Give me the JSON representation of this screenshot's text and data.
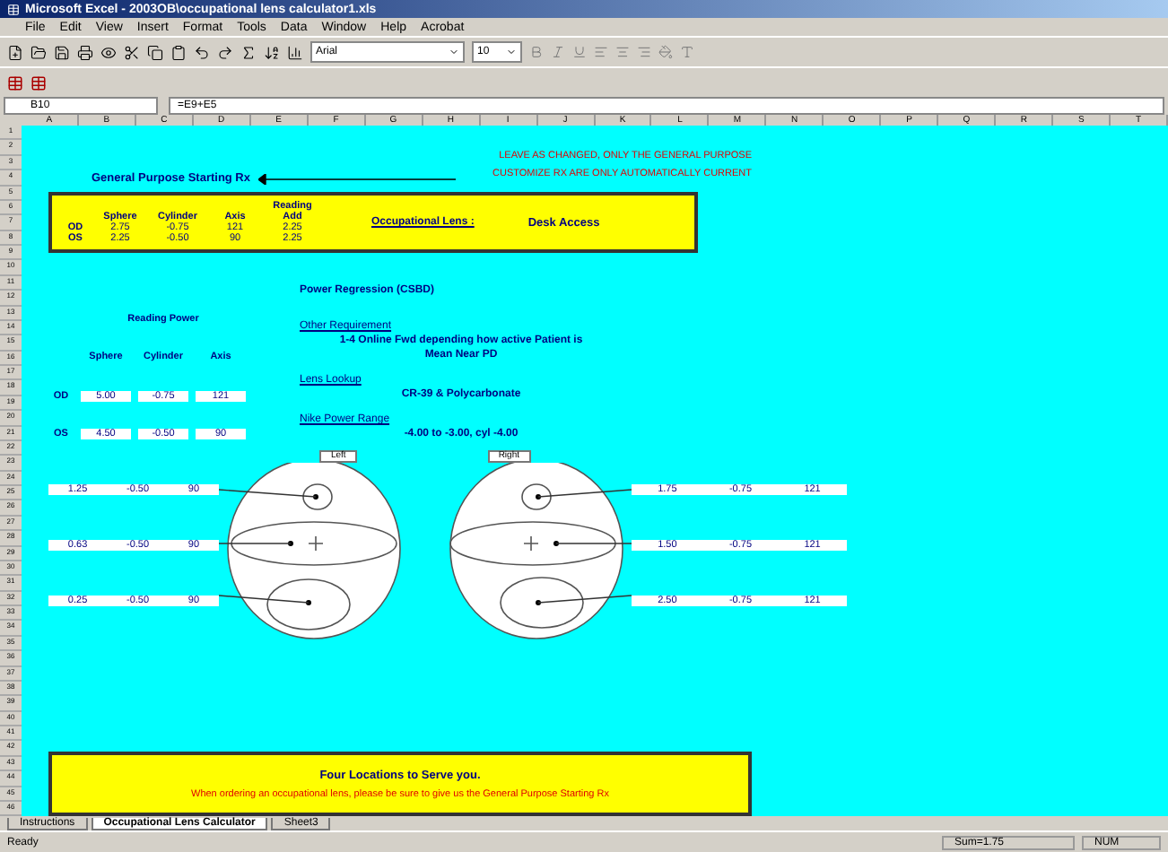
{
  "window": {
    "title": "Microsoft Excel - 2003OB\\occupational lens calculator1.xls"
  },
  "menu": [
    "File",
    "Edit",
    "View",
    "Insert",
    "Format",
    "Tools",
    "Data",
    "Window",
    "Help",
    "Acrobat"
  ],
  "toolbar": {
    "font": "Arial",
    "size": "10"
  },
  "formula_bar": {
    "cell": "B10",
    "formula": "=E9+E5"
  },
  "columns": [
    "A",
    "B",
    "C",
    "D",
    "E",
    "F",
    "G",
    "H",
    "I",
    "J",
    "K",
    "L",
    "M",
    "N",
    "O",
    "P",
    "Q",
    "R",
    "S",
    "T"
  ],
  "rows": [
    "1",
    "2",
    "3",
    "4",
    "5",
    "6",
    "7",
    "8",
    "9",
    "10",
    "11",
    "12",
    "13",
    "14",
    "15",
    "16",
    "17",
    "18",
    "19",
    "20",
    "21",
    "22",
    "23",
    "24",
    "25",
    "26",
    "27",
    "28",
    "29",
    "30",
    "31",
    "32",
    "33",
    "34",
    "35",
    "36",
    "37",
    "38",
    "39",
    "40",
    "41",
    "42",
    "43",
    "44",
    "45",
    "46"
  ],
  "sheet": {
    "notes": [
      "LEAVE AS CHANGED, ONLY THE GENERAL PURPOSE",
      "CUSTOMIZE RX ARE ONLY AUTOMATICALLY CURRENT"
    ],
    "starting_rx_label": "General Purpose Starting Rx",
    "rx_table": {
      "columns": [
        "Sphere",
        "Cylinder",
        "Axis",
        "Reading Add"
      ],
      "rows": [
        {
          "eye": "OD",
          "values": [
            "2.75",
            "-0.75",
            "121",
            "2.25"
          ]
        },
        {
          "eye": "OS",
          "values": [
            "2.25",
            "-0.50",
            "90",
            "2.25"
          ]
        }
      ]
    },
    "occupational": {
      "label": "Occupational Lens :",
      "value": "Desk Access"
    },
    "reading_table": {
      "title": "Reading Power",
      "columns": [
        "Sphere",
        "Cylinder",
        "Axis"
      ],
      "rows": [
        {
          "eye": "OD",
          "values": [
            "5.00",
            "-0.75",
            "121"
          ]
        },
        {
          "eye": "OS",
          "values": [
            "4.50",
            "-0.50",
            "90"
          ]
        }
      ]
    },
    "info": [
      {
        "kind": "heading",
        "text": "Power Regression (CSBD)"
      },
      {
        "kind": "label",
        "text": "Other Requirement"
      },
      {
        "kind": "value",
        "text": "1-4 Online Fwd depending how active Patient is"
      },
      {
        "kind": "value",
        "text": "Mean Near PD"
      },
      {
        "kind": "label",
        "text": "Lens Lookup"
      },
      {
        "kind": "value",
        "text": "CR-39 & Polycarbonate"
      },
      {
        "kind": "label",
        "text": "Nike Power Range"
      },
      {
        "kind": "value",
        "text": "-4.00 to -3.00, cyl -4.00"
      }
    ],
    "zones": [
      {
        "button": "Left",
        "readings": [
          [
            "1.25",
            "-0.50",
            "90"
          ],
          [
            "0.63",
            "-0.50",
            "90"
          ],
          [
            "0.25",
            "-0.50",
            "90"
          ]
        ]
      },
      {
        "button": "Right",
        "readings": [
          [
            "1.75",
            "-0.75",
            "121"
          ],
          [
            "1.50",
            "-0.75",
            "121"
          ],
          [
            "2.50",
            "-0.75",
            "121"
          ]
        ]
      }
    ],
    "footer": {
      "title": "Four Locations to Serve you.",
      "note": "When ordering an occupational lens, please be sure to give us the General Purpose Starting Rx"
    }
  },
  "sheet_tabs": [
    {
      "label": "Instructions",
      "selected": false
    },
    {
      "label": "Occupational Lens Calculator",
      "selected": true
    },
    {
      "label": "Sheet3",
      "selected": false
    }
  ],
  "status_bar": {
    "mode": "Ready",
    "sum": "Sum=1.75",
    "num": "NUM"
  }
}
